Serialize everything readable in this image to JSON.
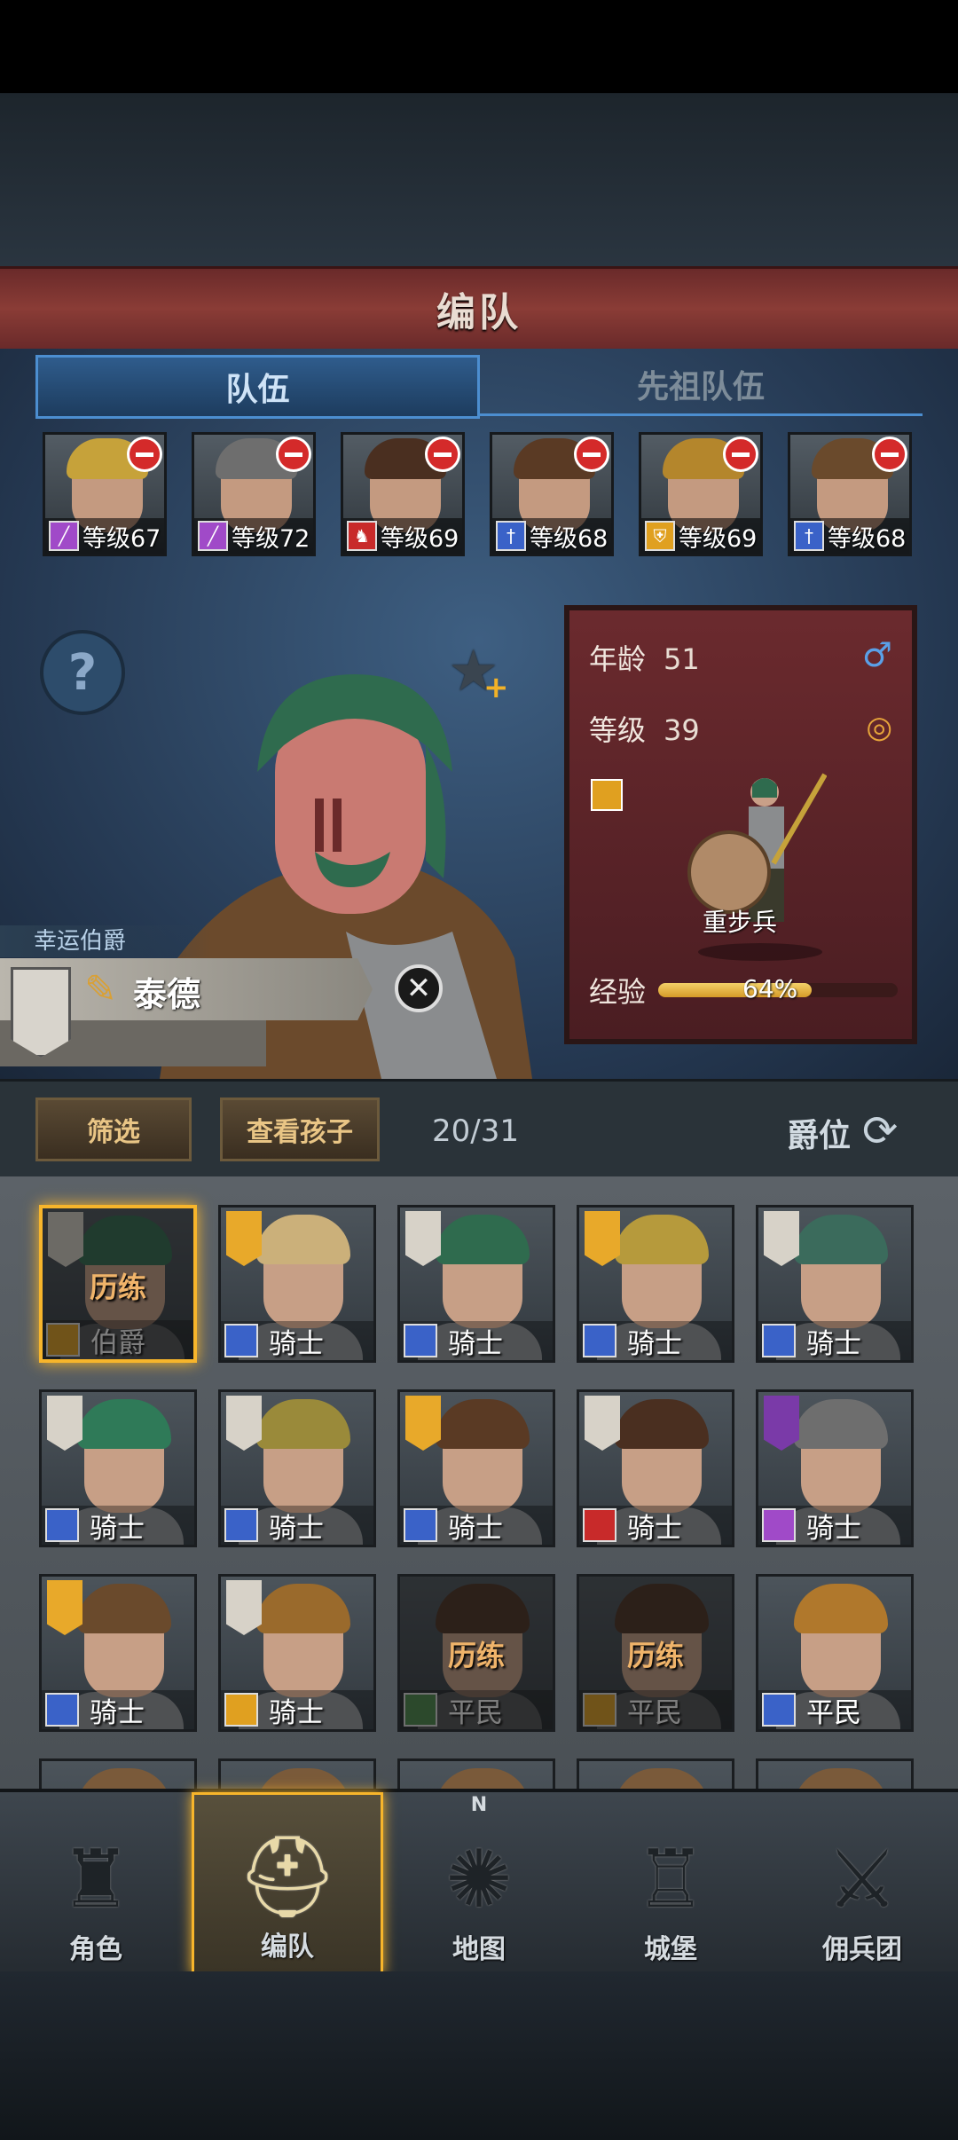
{
  "header": {
    "title": "编队"
  },
  "tabs": [
    {
      "label": "队伍",
      "active": true
    },
    {
      "label": "先祖队伍",
      "active": false
    }
  ],
  "squad": [
    {
      "level": "等级67",
      "class_icon": "staff-icon",
      "class_color": "#a04ac8",
      "hair": "#c6a23a"
    },
    {
      "level": "等级72",
      "class_icon": "staff-icon",
      "class_color": "#a04ac8",
      "hair": "#6e6e6e"
    },
    {
      "level": "等级69",
      "class_icon": "horse-icon",
      "class_color": "#c82a2a",
      "hair": "#4a2f20"
    },
    {
      "level": "等级68",
      "class_icon": "sword-icon",
      "class_color": "#3a62c8",
      "hair": "#5a3a24"
    },
    {
      "level": "等级69",
      "class_icon": "shield-icon",
      "class_color": "#e0a020",
      "hair": "#b4862c"
    },
    {
      "level": "等级68",
      "class_icon": "sword-icon",
      "class_color": "#3a62c8",
      "hair": "#6a4a2c"
    }
  ],
  "character": {
    "title": "幸运伯爵",
    "name": "泰德",
    "age_label": "年龄",
    "age": "51",
    "level_label": "等级",
    "level": "39",
    "unit_type": "重步兵",
    "exp_label": "经验",
    "exp_text": "64%",
    "exp_percent": 64,
    "gender_icon": "male-icon",
    "married_icon": "rings-icon"
  },
  "toolbar": {
    "filter": "筛选",
    "view_children": "查看孩子",
    "count": "20/31",
    "rank": "爵位"
  },
  "roster": [
    {
      "label": "伯爵",
      "train": "历练",
      "dimmed": true,
      "selected": true,
      "icon_color": "#e0a020",
      "hair": "#2f6b4e",
      "emblem": "#d7d2c8"
    },
    {
      "label": "骑士",
      "icon_color": "#3a62c8",
      "hair": "#cbb07a",
      "emblem": "#e8a92a"
    },
    {
      "label": "骑士",
      "icon_color": "#3a62c8",
      "hair": "#2f6b4e",
      "emblem": "#d7d2c8"
    },
    {
      "label": "骑士",
      "icon_color": "#3a62c8",
      "hair": "#b69a3c",
      "emblem": "#e8a92a"
    },
    {
      "label": "骑士",
      "icon_color": "#3a62c8",
      "hair": "#3b6b5c",
      "emblem": "#d7d2c8"
    },
    {
      "label": "骑士",
      "icon_color": "#3a62c8",
      "hair": "#2f7a58",
      "emblem": "#d7d2c8"
    },
    {
      "label": "骑士",
      "icon_color": "#3a62c8",
      "hair": "#9a8a3a",
      "emblem": "#d7d2c8"
    },
    {
      "label": "骑士",
      "icon_color": "#3a62c8",
      "hair": "#5a3a24",
      "emblem": "#e8a92a"
    },
    {
      "label": "骑士",
      "icon_color": "#c82a2a",
      "hair": "#4a2f20",
      "emblem": "#d7d2c8"
    },
    {
      "label": "骑士",
      "icon_color": "#a04ac8",
      "hair": "#6e6e6e",
      "emblem": "#7a3aa8"
    },
    {
      "label": "骑士",
      "icon_color": "#3a62c8",
      "hair": "#6a4a2c",
      "emblem": "#e8a92a"
    },
    {
      "label": "骑士",
      "icon_color": "#e0a020",
      "hair": "#9a6a2c",
      "emblem": "#d7d2c8"
    },
    {
      "label": "平民",
      "train": "历练",
      "dimmed": true,
      "icon_color": "#4a8a4a",
      "hair": "#4a2f20",
      "emblem": "none"
    },
    {
      "label": "平民",
      "train": "历练",
      "dimmed": true,
      "icon_color": "#e0a020",
      "hair": "#4a2f20",
      "emblem": "none"
    },
    {
      "label": "平民",
      "icon_color": "#3a62c8",
      "hair": "#b0782c",
      "emblem": "none"
    }
  ],
  "nav": [
    {
      "label": "角色",
      "icon": "knight-icon"
    },
    {
      "label": "编队",
      "icon": "helmet-icon",
      "active": true
    },
    {
      "label": "地图",
      "icon": "compass-icon",
      "compass_n": "N"
    },
    {
      "label": "城堡",
      "icon": "castle-icon"
    },
    {
      "label": "佣兵团",
      "icon": "mercenary-icon"
    }
  ]
}
